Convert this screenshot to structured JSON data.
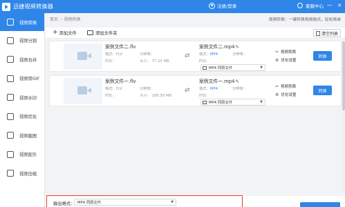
{
  "window": {
    "title": "迅捷视频转换器",
    "login": "注册/登录",
    "service": "客服中心",
    "min": "—",
    "close": "×"
  },
  "sidebar": {
    "items": [
      {
        "label": "视频转换",
        "icon": "video-convert-icon",
        "active": true
      },
      {
        "label": "视频分割",
        "icon": "split-icon"
      },
      {
        "label": "视频合并",
        "icon": "merge-icon"
      },
      {
        "label": "视频转GIF",
        "icon": "gif-icon"
      },
      {
        "label": "视频水印",
        "icon": "watermark-icon"
      },
      {
        "label": "视频优化",
        "icon": "optimize-icon"
      },
      {
        "label": "视频截图",
        "icon": "screenshot-icon"
      },
      {
        "label": "视频配乐",
        "icon": "music-icon"
      },
      {
        "label": "视频压缩",
        "icon": "compress-icon"
      }
    ]
  },
  "breadcrumb": {
    "home": "首页",
    "current": "视频转换"
  },
  "tip": "视频转换：一键转换视频格式，轻松简单",
  "toolbar": {
    "add_file": "添加文件",
    "add_folder": "添加文件夹",
    "clear": "清空列表"
  },
  "files": [
    {
      "name": "案例文件二.flv",
      "format_label": "格式：",
      "format": "FLV",
      "res_label": "分辨率：",
      "res": "",
      "duration_label": "时长：",
      "duration": "",
      "size_label": "大小：",
      "size": "77.25 MB",
      "out_name": "案例文件二.mp4",
      "out_format": "MP4",
      "out_res_label": "分辨率：",
      "out_duration_label": "时长：",
      "select": "MP4  同原文件",
      "cut": "视频剪裁",
      "optimize": "优化设置",
      "convert": "转换"
    },
    {
      "name": "案例文件一.flv",
      "format_label": "格式：",
      "format": "FLV",
      "res_label": "分辨率：",
      "res": "",
      "duration_label": "时长：",
      "duration": "",
      "size_label": "大小：",
      "size": "186.58 MB",
      "out_name": "案例文件一.mp4",
      "out_format": "MP4",
      "out_res_label": "分辨率：",
      "out_duration_label": "时长：",
      "select": "MP4  同原文件",
      "cut": "视频剪裁",
      "optimize": "优化设置",
      "convert": "转换"
    }
  ],
  "output": {
    "label": "输出格式：",
    "value": "MP4  同原文件"
  }
}
